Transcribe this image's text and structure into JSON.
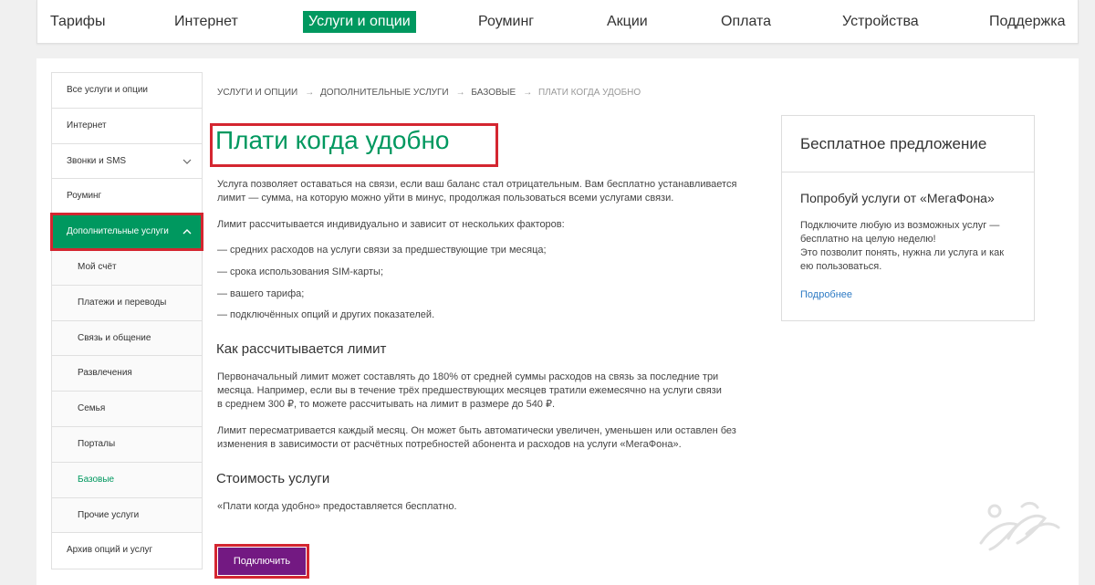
{
  "topnav": {
    "items": [
      "Тарифы",
      "Интернет",
      "Услуги и опции",
      "Роуминг",
      "Акции",
      "Оплата",
      "Устройства",
      "Поддержка"
    ]
  },
  "sidebar": {
    "items": [
      {
        "label": "Все услуги и опции"
      },
      {
        "label": "Интернет"
      },
      {
        "label": "Звонки и SMS"
      },
      {
        "label": "Роуминг"
      },
      {
        "label": "Дополнительные услуги"
      },
      {
        "label": "Мой счёт"
      },
      {
        "label": "Платежи и переводы"
      },
      {
        "label": "Связь и общение"
      },
      {
        "label": "Развлечения"
      },
      {
        "label": "Семья"
      },
      {
        "label": "Порталы"
      },
      {
        "label": "Базовые"
      },
      {
        "label": "Прочие услуги"
      },
      {
        "label": "Архив опций и услуг"
      }
    ]
  },
  "breadcrumb": {
    "items": [
      "УСЛУГИ И ОПЦИИ",
      "ДОПОЛНИТЕЛЬНЫЕ УСЛУГИ",
      "БАЗОВЫЕ"
    ],
    "current": "ПЛАТИ КОГДА УДОБНО",
    "separator": "→"
  },
  "main": {
    "title": "Плати когда удобно",
    "intro": "Услуга позволяет оставаться на связи, если ваш баланс стал отрицательным. Вам бесплатно устанавливается лимит — сумма, на которую можно уйти в минус, продолжая пользоваться всеми услугами связи.",
    "factors_intro": "Лимит рассчитывается индивидуально и зависит от нескольких факторов:",
    "factors": [
      "—  средних расходов на услуги связи за предшествующие три месяца;",
      "—  срока использования SIM-карты;",
      "—  вашего тарифа;",
      "—  подключённых опций и других показателей."
    ],
    "limit_heading": "Как рассчитывается лимит",
    "limit_p1_l1": "Первоначальный лимит может составлять до 180% от средней суммы расходов на связь за последние три",
    "limit_p1_l2": "месяца. Например, если вы в течение трёх предшествующих месяцев тратили ежемесячно на услуги связи",
    "limit_p1_l3": "в среднем 300 ₽, то можете рассчитывать на лимит в размере до 540 ₽.",
    "limit_p2_l1": "Лимит пересматривается каждый месяц. Он может быть автоматически увеличен, уменьшен или оставлен без",
    "limit_p2_l2": "изменения в зависимости от расчётных потребностей абонента и расходов на услуги «МегаФона».",
    "cost_heading": "Стоимость услуги",
    "cost_text": "«Плати когда удобно» предоставляется бесплатно.",
    "connect_label": "Подключить"
  },
  "promo": {
    "heading": "Бесплатное предложение",
    "subheading": "Попробуй услуги от «МегаФона»",
    "desc_l1": "Подключите любую из возможных услуг —",
    "desc_l2": "бесплатно на целую неделю!",
    "desc_l3": "Это позволит понять, нужна ли услуга и как",
    "desc_l4": "ею пользоваться.",
    "more_label": "Подробнее"
  },
  "colors": {
    "brand_green": "#00985f",
    "brand_purple": "#731982",
    "highlight_red": "#d42630",
    "link_blue": "#2e7bc4"
  }
}
